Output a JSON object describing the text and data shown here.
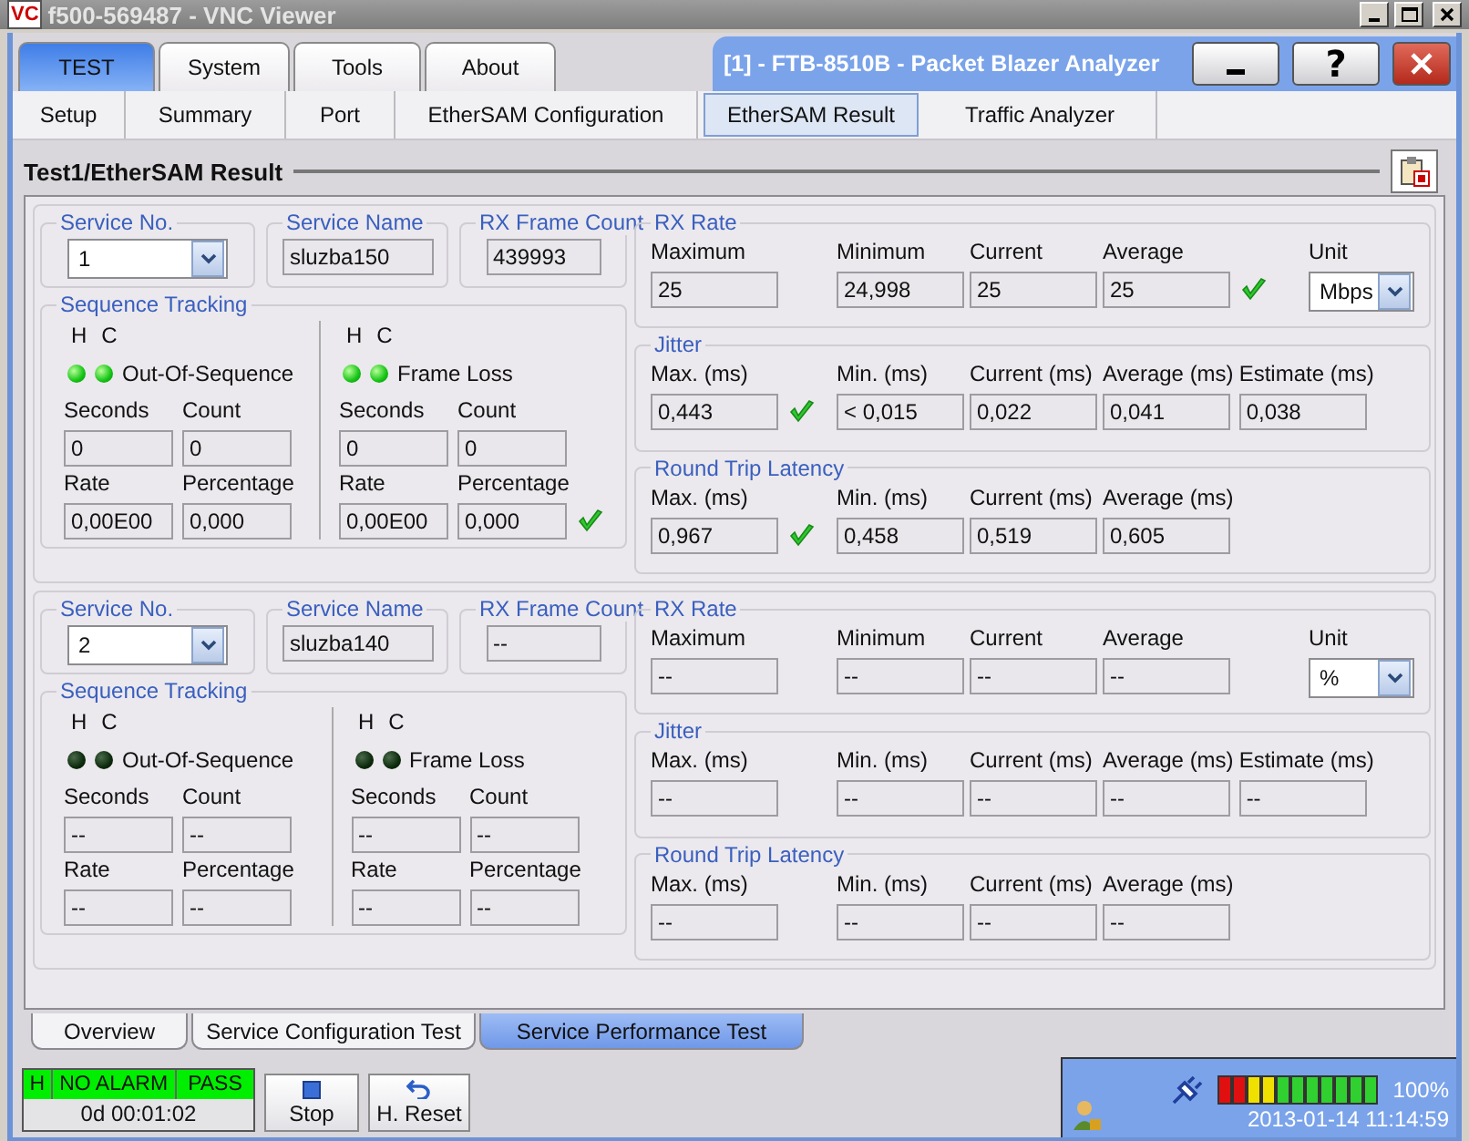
{
  "vnc_window": {
    "logo": "VC",
    "title": "f500-569487 - VNC Viewer"
  },
  "main_tabs": [
    {
      "label": "TEST",
      "selected": true
    },
    {
      "label": "System",
      "selected": false
    },
    {
      "label": "Tools",
      "selected": false
    },
    {
      "label": "About",
      "selected": false
    }
  ],
  "app_title": "[1] - FTB-8510B - Packet Blazer Analyzer",
  "app_buttons": [
    {
      "kind": "minimize"
    },
    {
      "kind": "help",
      "label": "?"
    },
    {
      "kind": "close"
    }
  ],
  "sub_tabs": [
    {
      "label": "Setup",
      "selected": false
    },
    {
      "label": "Summary",
      "selected": false
    },
    {
      "label": "Port",
      "selected": false
    },
    {
      "label": "EtherSAM Configuration",
      "selected": false
    },
    {
      "label": "EtherSAM Result",
      "selected": true
    },
    {
      "label": "Traffic Analyzer",
      "selected": false
    }
  ],
  "section_title": "Test1/EtherSAM Result",
  "services": [
    {
      "service_no": {
        "legend": "Service No.",
        "value": "1"
      },
      "service_name": {
        "legend": "Service Name",
        "value": "sluzba150"
      },
      "rx_frame_count": {
        "legend": "RX Frame Count",
        "value": "439993"
      },
      "sequence_tracking": {
        "legend": "Sequence Tracking",
        "monitors": [
          {
            "h_label": "H",
            "c_label": "C",
            "h_on": true,
            "c_on": true,
            "label": "Out-Of-Sequence",
            "fields": [
              {
                "label": "Seconds",
                "value": "0",
                "pass": false
              },
              {
                "label": "Count",
                "value": "0",
                "pass": false
              },
              {
                "label": "Rate",
                "value": "0,00E00",
                "pass": false
              },
              {
                "label": "Percentage",
                "value": "0,000",
                "pass": false
              }
            ]
          },
          {
            "h_label": "H",
            "c_label": "C",
            "h_on": true,
            "c_on": true,
            "label": "Frame Loss",
            "fields": [
              {
                "label": "Seconds",
                "value": "0",
                "pass": false
              },
              {
                "label": "Count",
                "value": "0",
                "pass": false
              },
              {
                "label": "Rate",
                "value": "0,00E00",
                "pass": false
              },
              {
                "label": "Percentage",
                "value": "0,000",
                "pass": true
              }
            ]
          }
        ]
      },
      "rx_rate": {
        "legend": "RX Rate",
        "fields": [
          {
            "label": "Maximum",
            "value": "25",
            "pass": false
          },
          {
            "label": "Minimum",
            "value": "24,998",
            "pass": false
          },
          {
            "label": "Current",
            "value": "25",
            "pass": false
          },
          {
            "label": "Average",
            "value": "25",
            "pass": true
          }
        ],
        "unit": {
          "label": "Unit",
          "value": "Mbps"
        }
      },
      "jitter": {
        "legend": "Jitter",
        "fields": [
          {
            "label": "Max. (ms)",
            "value": "0,443",
            "pass": true
          },
          {
            "label": "Min. (ms)",
            "value": "< 0,015",
            "pass": false
          },
          {
            "label": "Current (ms)",
            "value": "0,022",
            "pass": false
          },
          {
            "label": "Average (ms)",
            "value": "0,041",
            "pass": false
          },
          {
            "label": "Estimate (ms)",
            "value": "0,038",
            "pass": false
          }
        ]
      },
      "round_trip_latency": {
        "legend": "Round Trip Latency",
        "fields": [
          {
            "label": "Max. (ms)",
            "value": "0,967",
            "pass": true
          },
          {
            "label": "Min. (ms)",
            "value": "0,458",
            "pass": false
          },
          {
            "label": "Current (ms)",
            "value": "0,519",
            "pass": false
          },
          {
            "label": "Average (ms)",
            "value": "0,605",
            "pass": false
          }
        ]
      }
    },
    {
      "service_no": {
        "legend": "Service No.",
        "value": "2"
      },
      "service_name": {
        "legend": "Service Name",
        "value": "sluzba140"
      },
      "rx_frame_count": {
        "legend": "RX Frame Count",
        "value": "--"
      },
      "sequence_tracking": {
        "legend": "Sequence Tracking",
        "monitors": [
          {
            "h_label": "H",
            "c_label": "C",
            "h_on": false,
            "c_on": false,
            "label": "Out-Of-Sequence",
            "fields": [
              {
                "label": "Seconds",
                "value": "--",
                "pass": false
              },
              {
                "label": "Count",
                "value": "--",
                "pass": false
              },
              {
                "label": "Rate",
                "value": "--",
                "pass": false
              },
              {
                "label": "Percentage",
                "value": "--",
                "pass": false
              }
            ]
          },
          {
            "h_label": "H",
            "c_label": "C",
            "h_on": false,
            "c_on": false,
            "label": "Frame Loss",
            "fields": [
              {
                "label": "Seconds",
                "value": "--",
                "pass": false
              },
              {
                "label": "Count",
                "value": "--",
                "pass": false
              },
              {
                "label": "Rate",
                "value": "--",
                "pass": false
              },
              {
                "label": "Percentage",
                "value": "--",
                "pass": false
              }
            ]
          }
        ]
      },
      "rx_rate": {
        "legend": "RX Rate",
        "fields": [
          {
            "label": "Maximum",
            "value": "--",
            "pass": false
          },
          {
            "label": "Minimum",
            "value": "--",
            "pass": false
          },
          {
            "label": "Current",
            "value": "--",
            "pass": false
          },
          {
            "label": "Average",
            "value": "--",
            "pass": false
          }
        ],
        "unit": {
          "label": "Unit",
          "value": "%"
        }
      },
      "jitter": {
        "legend": "Jitter",
        "fields": [
          {
            "label": "Max. (ms)",
            "value": "--",
            "pass": false
          },
          {
            "label": "Min. (ms)",
            "value": "--",
            "pass": false
          },
          {
            "label": "Current (ms)",
            "value": "--",
            "pass": false
          },
          {
            "label": "Average (ms)",
            "value": "--",
            "pass": false
          },
          {
            "label": "Estimate (ms)",
            "value": "--",
            "pass": false
          }
        ]
      },
      "round_trip_latency": {
        "legend": "Round Trip Latency",
        "fields": [
          {
            "label": "Max. (ms)",
            "value": "--",
            "pass": false
          },
          {
            "label": "Min. (ms)",
            "value": "--",
            "pass": false
          },
          {
            "label": "Current (ms)",
            "value": "--",
            "pass": false
          },
          {
            "label": "Average (ms)",
            "value": "--",
            "pass": false
          }
        ]
      }
    }
  ],
  "bottom_tabs": [
    {
      "label": "Overview",
      "selected": false
    },
    {
      "label": "Service Configuration Test",
      "selected": false
    },
    {
      "label": "Service Performance Test",
      "selected": true
    }
  ],
  "status": {
    "alarm_cells": [
      "H",
      "NO ALARM",
      "PASS"
    ],
    "timer": "0d 00:01:02"
  },
  "actions": [
    {
      "kind": "stop",
      "label": "Stop"
    },
    {
      "kind": "reset",
      "label": "H. Reset"
    }
  ],
  "tray": {
    "battery": {
      "level": 1,
      "reading": "100%"
    },
    "datetime": "2013-01-14 11:14:59"
  }
}
